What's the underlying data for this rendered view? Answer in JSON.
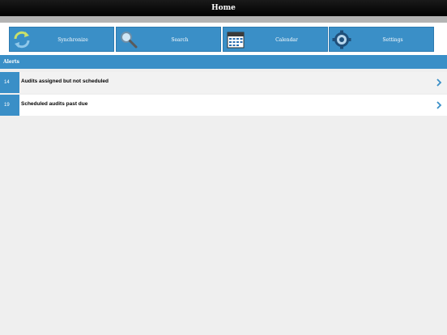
{
  "header": {
    "title": "Home"
  },
  "toolbar": {
    "buttons": [
      {
        "label": "Synchronize",
        "icon": "sync-icon"
      },
      {
        "label": "Search",
        "icon": "magnifier-icon"
      },
      {
        "label": "Calendar",
        "icon": "calendar-icon"
      },
      {
        "label": "Settings",
        "icon": "gear-icon"
      }
    ]
  },
  "alerts": {
    "title": "Alerts",
    "items": [
      {
        "count": "14",
        "text": "Audits assigned but not scheduled"
      },
      {
        "count": "19",
        "text": "Scheduled audits past due"
      }
    ]
  },
  "colors": {
    "accent": "#3a8fc7",
    "titlebar": "#000000",
    "row_alt": "#f2f2f2",
    "row": "#ffffff",
    "background": "#efefef"
  }
}
